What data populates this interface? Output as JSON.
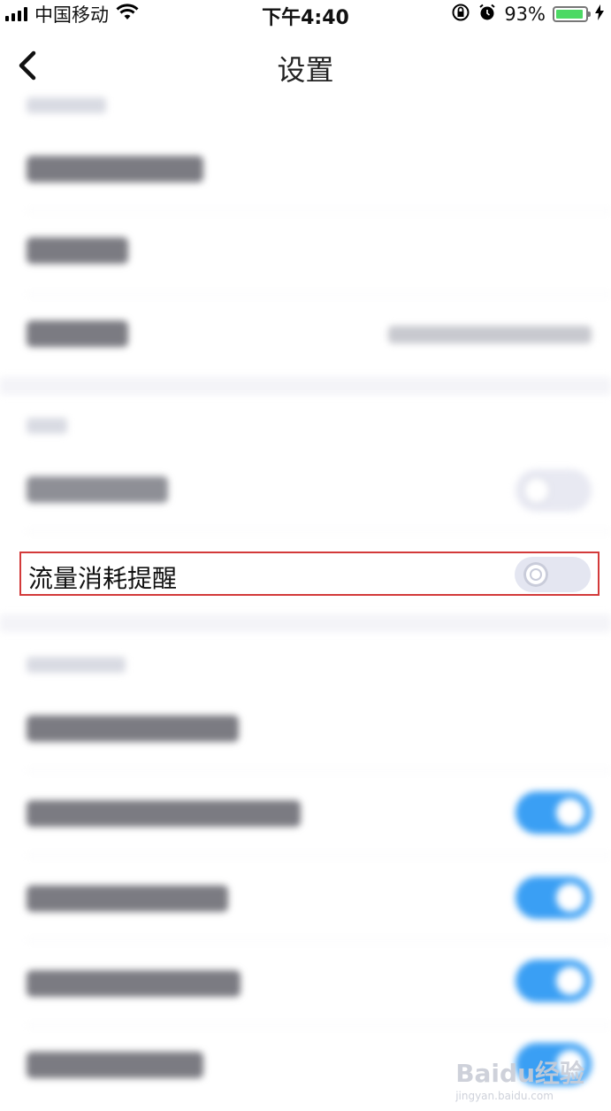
{
  "status_bar": {
    "carrier": "中国移动",
    "time": "下午4:40",
    "battery_percent": "93%",
    "battery_level": 0.93,
    "icons": [
      "signal-icon",
      "wifi-icon",
      "orientation-lock-icon",
      "alarm-icon",
      "battery-icon",
      "charging-icon"
    ]
  },
  "nav": {
    "title": "设置",
    "back_icon": "chevron-left-icon"
  },
  "highlight": {
    "label": "流量消耗提醒",
    "toggle_on": false
  },
  "toggles": {
    "wifi_only": false,
    "row_b": true,
    "row_c": true,
    "row_d": true,
    "row_e": true
  },
  "watermark": {
    "text": "Baidu经验",
    "sub": "jingyan.baidu.com"
  },
  "colors": {
    "toggle_on": "#3a9ff4",
    "toggle_off": "#e8e9f2",
    "highlight_border": "#d33a3a"
  }
}
